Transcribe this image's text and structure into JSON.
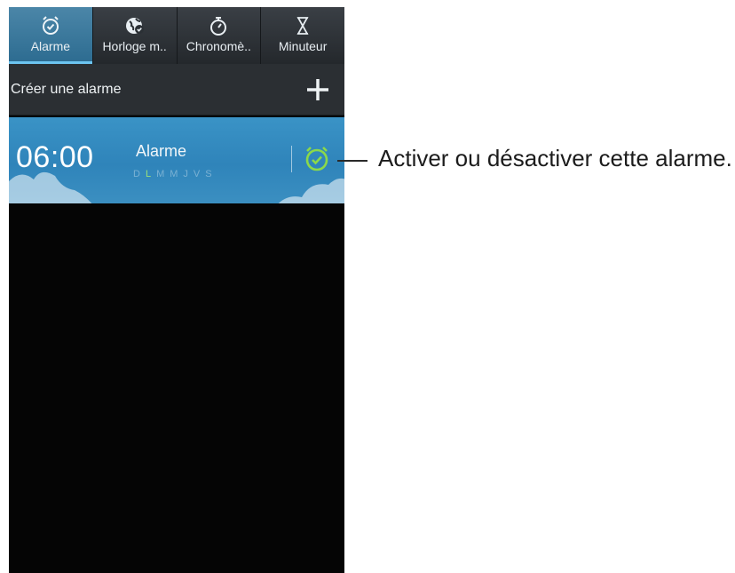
{
  "tabs": [
    {
      "label": "Alarme",
      "icon": "alarm-clock-icon",
      "active": true
    },
    {
      "label": "Horloge m..",
      "icon": "world-clock-icon",
      "active": false
    },
    {
      "label": "Chronomè..",
      "icon": "stopwatch-icon",
      "active": false
    },
    {
      "label": "Minuteur",
      "icon": "hourglass-icon",
      "active": false
    }
  ],
  "create": {
    "label": "Créer une alarme",
    "icon": "plus-icon"
  },
  "alarm": {
    "time": "06:00",
    "name": "Alarme",
    "days": [
      "D",
      "L",
      "M",
      "M",
      "J",
      "V",
      "S"
    ],
    "active_day_index": 1,
    "toggle_icon": "alarm-clock-icon",
    "toggle_color": "#8bd94a"
  },
  "callout": {
    "text": "Activer ou désactiver cette alarme."
  },
  "colors": {
    "accent": "#6cc4f0",
    "alarm_bg": "#2f84ba",
    "toggle_on": "#8bd94a"
  }
}
